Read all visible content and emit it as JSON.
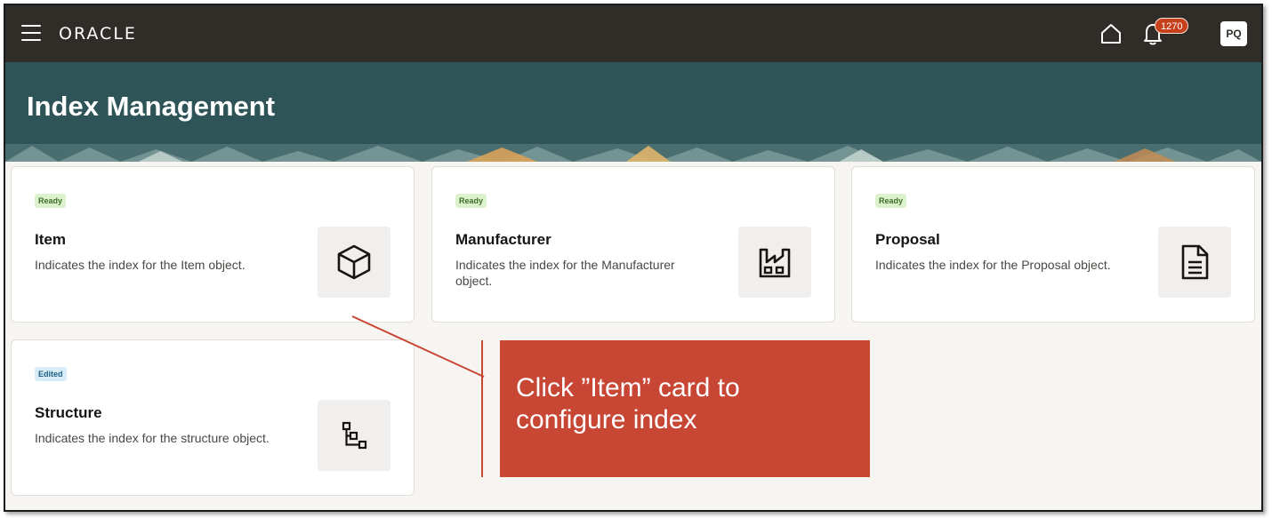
{
  "topbar": {
    "brand": "ORACLE",
    "notification_count": "1270",
    "avatar_initials": "PQ"
  },
  "header": {
    "title": "Index Management"
  },
  "cards": [
    {
      "status": "Ready",
      "title": "Item",
      "description": "Indicates the index for the Item object.",
      "icon": "cube-icon"
    },
    {
      "status": "Ready",
      "title": "Manufacturer",
      "description": "Indicates the index for the Manufacturer object.",
      "icon": "factory-icon"
    },
    {
      "status": "Ready",
      "title": "Proposal",
      "description": "Indicates the index for the Proposal object.",
      "icon": "document-icon"
    },
    {
      "status": "Edited",
      "title": "Structure",
      "description": "Indicates the index for the structure object.",
      "icon": "hierarchy-icon"
    }
  ],
  "callout": {
    "text": "Click ”Item” card to configure index"
  },
  "colors": {
    "topbar": "#302c28",
    "header": "#2f5457",
    "callout": "#c74634",
    "badge": "#c7401c"
  }
}
